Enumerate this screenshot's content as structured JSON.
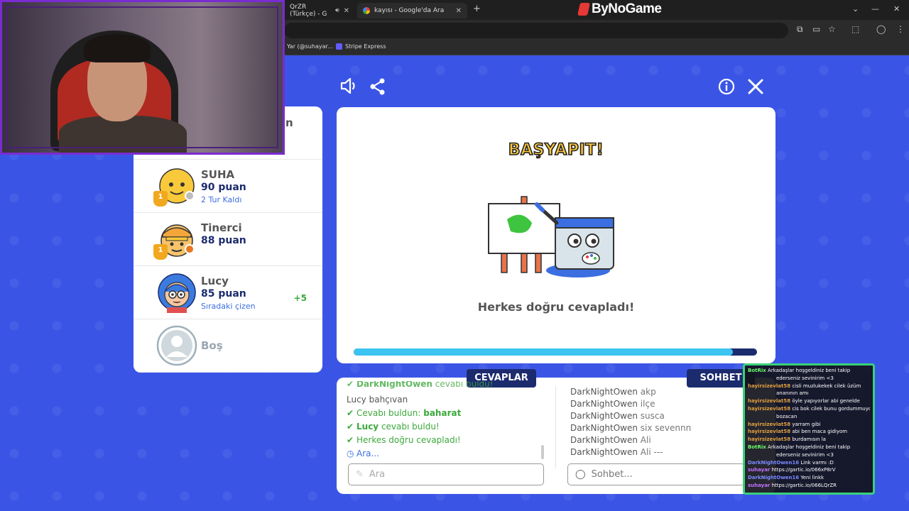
{
  "browser": {
    "tabs": [
      {
        "label": "QrZR (Türkçe) - G",
        "active": false
      },
      {
        "label": "kayısı - Google'da Ara",
        "active": true
      }
    ],
    "new_tab": "+",
    "brand": "ByNoGame",
    "bookmarks": [
      {
        "label": "Yar (@suhayar..."
      },
      {
        "label": "Stripe Express"
      }
    ]
  },
  "game": {
    "players": [
      {
        "name": "SUHA",
        "points": "90 puan",
        "sub": "2 Tur Kaldı",
        "bonus": "",
        "rank": "1",
        "avatar_color": "#f9c93c",
        "status_color": "#bdbdbd"
      },
      {
        "name": "Tinerci",
        "points": "88 puan",
        "sub": "",
        "bonus": "",
        "rank": "1",
        "avatar_color": "#f4a63a",
        "status_color": "#e87722"
      },
      {
        "name": "Lucy",
        "points": "85 puan",
        "sub": "Sıradaki çizen",
        "bonus": "+5",
        "rank": "",
        "avatar_color": "#3b7be0",
        "status_color": ""
      },
      {
        "name": "Boş",
        "points": "",
        "sub": "",
        "bonus": "",
        "rank": "",
        "avatar_color": "#cfd8dc",
        "status_color": ""
      }
    ],
    "partial_player_name": "n",
    "main": {
      "title": "BAŞYAPIT!",
      "message": "Herkes doğru cevapladı!",
      "progress": 0.94
    },
    "answers": {
      "header": "CEVAPLAR",
      "lines": [
        {
          "user": "DarkNightOwen",
          "text": "cevabı buldu!",
          "kind": "green-partial"
        },
        {
          "user": "Lucy",
          "text": "bahçıvan",
          "kind": "normal"
        },
        {
          "text_before": "Cevabı buldun: ",
          "bold": "baharat",
          "kind": "green"
        },
        {
          "bold": "Lucy",
          "text": " cevabı buldu!",
          "kind": "green"
        },
        {
          "text": "Herkes doğru cevapladı!",
          "kind": "green"
        },
        {
          "text": "Ara...",
          "kind": "blue"
        }
      ],
      "input_placeholder": "Ara"
    },
    "chat": {
      "header": "SOHBET",
      "lines": [
        {
          "user": "DarkNightOwen",
          "text": "akp"
        },
        {
          "user": "DarkNightOwen",
          "text": "ilçe"
        },
        {
          "user": "DarkNightOwen",
          "text": "susca"
        },
        {
          "user": "DarkNightOwen",
          "text": "six sevennn"
        },
        {
          "user": "DarkNightOwen",
          "text": "Ali"
        },
        {
          "user": "DarkNightOwen",
          "text": "Ali ---"
        }
      ],
      "input_placeholder": "Sohbet..."
    }
  },
  "stream_chat": [
    {
      "user": "BotRix",
      "text": "Arkadaşlar hoşgeldiniz beni takip",
      "color": "#6aff6a"
    },
    {
      "user": "",
      "text": "ederseniz sevinirim <3",
      "color": ""
    },
    {
      "user": "hayirsizevlat58",
      "text": "cisli muzlukekek cilek üzüm",
      "color": "#e0a040"
    },
    {
      "user": "",
      "text": "ananının amı",
      "color": ""
    },
    {
      "user": "hayirsizevlat58",
      "text": "öyle yapıyorlar abi genelde",
      "color": "#e0a040"
    },
    {
      "user": "hayirsizevlat58",
      "text": "cis bok cilek bunu gordummuydu",
      "color": "#e0a040"
    },
    {
      "user": "",
      "text": "bozacan",
      "color": ""
    },
    {
      "user": "hayirsizevlat58",
      "text": "yarram gibi",
      "color": "#e0a040"
    },
    {
      "user": "hayirsizevlat58",
      "text": "abi ben maca gidiyom",
      "color": "#e0a040"
    },
    {
      "user": "hayirsizevlat58",
      "text": "burdamısın la",
      "color": "#e0a040"
    },
    {
      "user": "BotRix",
      "text": "Arkadaşlar hoşgeldiniz beni takip",
      "color": "#6aff6a"
    },
    {
      "user": "",
      "text": "ederseniz sevinirim <3",
      "color": ""
    },
    {
      "user": "DarkNightOwen16",
      "text": "Link varmı :D",
      "color": "#7a8aff"
    },
    {
      "user": "suhayar",
      "text": "https://gartic.io/066xP8rV",
      "color": "#c070ff"
    },
    {
      "user": "DarkNightOwen16",
      "text": "Yeni linkk",
      "color": "#7a8aff"
    },
    {
      "user": "suhayar",
      "text": "https://gartic.io/066LQrZR",
      "color": "#c070ff"
    }
  ]
}
